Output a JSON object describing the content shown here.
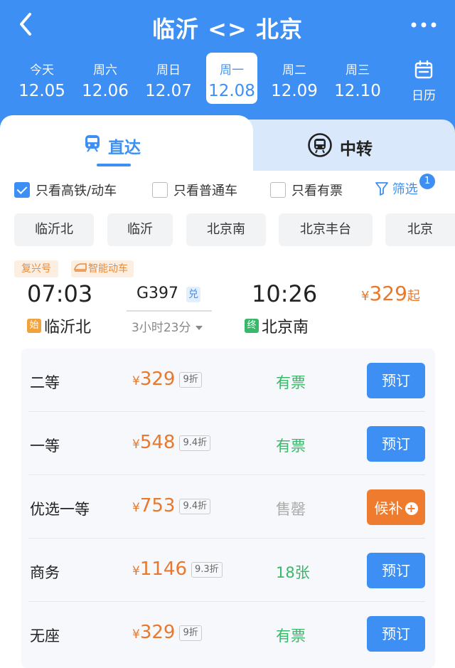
{
  "header": {
    "title": "临沂 <> 北京",
    "colors": {
      "primary": "#3d8ff3",
      "accent": "#e8792c",
      "available": "#3ab86a"
    },
    "back_icon": "chevron-left-icon",
    "more_icon": "more-horizontal-icon"
  },
  "dates": [
    {
      "weekday": "今天",
      "date": "12.05"
    },
    {
      "weekday": "周六",
      "date": "12.06"
    },
    {
      "weekday": "周日",
      "date": "12.07"
    },
    {
      "weekday": "周一",
      "date": "12.08",
      "selected": true
    },
    {
      "weekday": "周二",
      "date": "12.09"
    },
    {
      "weekday": "周三",
      "date": "12.10"
    }
  ],
  "calendar": {
    "label": "日历",
    "icon": "calendar-icon"
  },
  "tabs": {
    "direct": {
      "label": "直达",
      "icon": "train-icon",
      "active": true
    },
    "transfer": {
      "label": "中转",
      "icon": "train-circle-icon"
    }
  },
  "filters": {
    "high_speed": {
      "label": "只看高铁/动车",
      "checked": true
    },
    "normal": {
      "label": "只看普通车",
      "checked": false
    },
    "available": {
      "label": "只看有票",
      "checked": false
    },
    "filter_label": "筛选",
    "filter_count": "1"
  },
  "stations": [
    "临沂北",
    "临沂",
    "北京南",
    "北京丰台",
    "北京"
  ],
  "train": {
    "tags": {
      "type": "复兴号",
      "smart": "智能动车"
    },
    "depart_time": "07:03",
    "arrive_time": "10:26",
    "number": "G397",
    "redeem": "兑",
    "duration": "3小时23分",
    "from_mark": "始",
    "from": "临沂北",
    "to_mark": "终",
    "to": "北京南",
    "lowest_price": {
      "currency": "¥",
      "value": "329",
      "suffix": "起"
    }
  },
  "seats": [
    {
      "name": "二等",
      "currency": "¥",
      "price": "329",
      "discount": "9折",
      "availability": "有票",
      "action": "预订"
    },
    {
      "name": "一等",
      "currency": "¥",
      "price": "548",
      "discount": "9.4折",
      "availability": "有票",
      "action": "预订"
    },
    {
      "name": "优选一等",
      "currency": "¥",
      "price": "753",
      "discount": "9.4折",
      "availability": "售罄",
      "action": "候补"
    },
    {
      "name": "商务",
      "currency": "¥",
      "price": "1146",
      "discount": "9.3折",
      "availability": "18张",
      "action": "预订"
    },
    {
      "name": "无座",
      "currency": "¥",
      "price": "329",
      "discount": "9折",
      "availability": "有票",
      "action": "预订"
    }
  ]
}
